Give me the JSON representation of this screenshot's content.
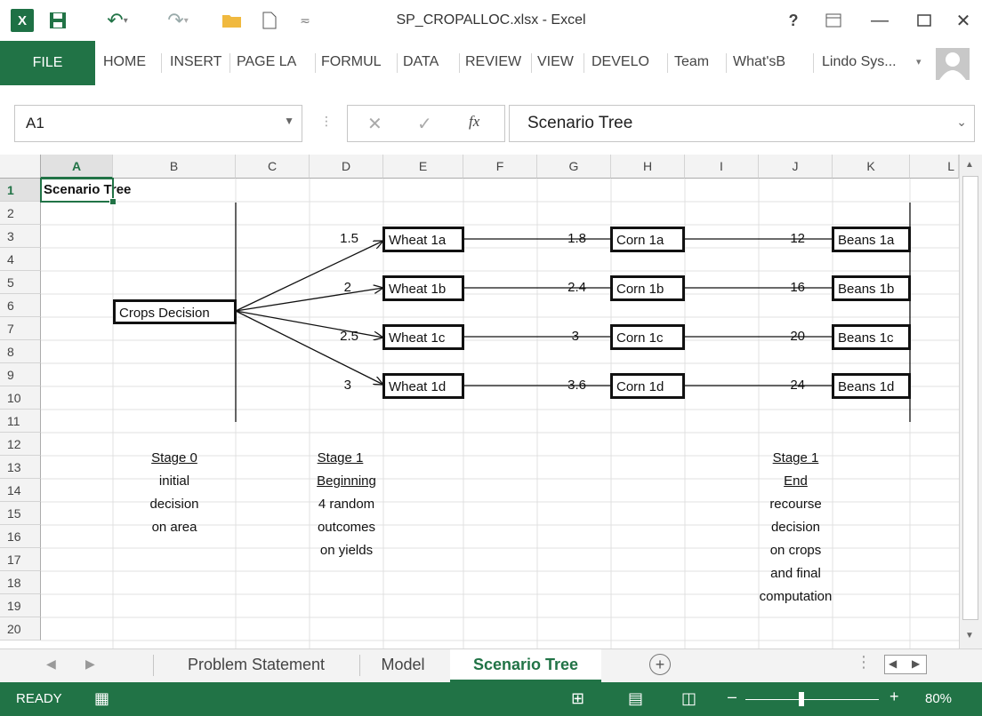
{
  "app": {
    "window_title": "SP_CROPALLOC.xlsx - Excel",
    "help": "?",
    "file_tab": "FILE",
    "tabs": [
      "HOME",
      "INSERT",
      "PAGE LA",
      "FORMUL",
      "DATA",
      "REVIEW",
      "VIEW",
      "DEVELO",
      "Team",
      "What'sB",
      "Lindo Sys..."
    ]
  },
  "formula_bar": {
    "name_box": "A1",
    "fx": "fx",
    "formula": "Scenario Tree"
  },
  "grid": {
    "columns": [
      "A",
      "B",
      "C",
      "D",
      "E",
      "F",
      "G",
      "H",
      "I",
      "J",
      "K",
      "L"
    ],
    "rows": [
      "1",
      "2",
      "3",
      "4",
      "5",
      "6",
      "7",
      "8",
      "9",
      "10",
      "11",
      "12",
      "13",
      "14",
      "15",
      "16",
      "17",
      "18",
      "19",
      "20"
    ],
    "selected_cell": "A1",
    "a1": "Scenario Tree",
    "root_box": "Crops Decision",
    "d_values": [
      "1.5",
      "2",
      "2.5",
      "3"
    ],
    "wheat": [
      "Wheat 1a",
      "Wheat 1b",
      "Wheat 1c",
      "Wheat 1d"
    ],
    "g_values": [
      "1.8",
      "2.4",
      "3",
      "3.6"
    ],
    "corn": [
      "Corn 1a",
      "Corn 1b",
      "Corn 1c",
      "Corn 1d"
    ],
    "j_values": [
      "12",
      "16",
      "20",
      "24"
    ],
    "beans": [
      "Beans 1a",
      "Beans 1b",
      "Beans 1c",
      "Beans 1d"
    ],
    "stage0": [
      "Stage 0",
      "initial",
      "decision",
      "on area"
    ],
    "stage1_begin": [
      "Stage 1",
      "Beginning",
      "4 random",
      "outcomes",
      "on yields"
    ],
    "stage1_end": [
      "Stage 1",
      "End",
      "recourse",
      "decision",
      "on crops",
      "and final",
      "computation"
    ]
  },
  "sheets": {
    "tabs": [
      "Problem Statement",
      "Model",
      "Scenario Tree"
    ],
    "active": "Scenario Tree"
  },
  "status": {
    "ready": "READY",
    "zoom": "80%"
  }
}
